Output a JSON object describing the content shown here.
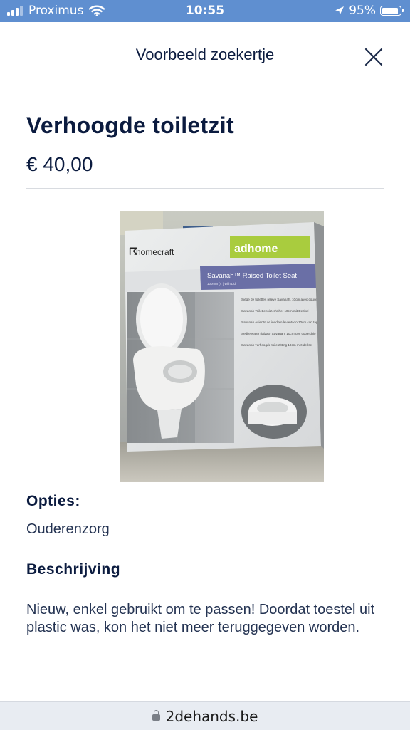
{
  "status_bar": {
    "carrier": "Proximus",
    "time": "10:55",
    "battery": "95%",
    "battery_level": 0.95,
    "signal_bars_active": 3,
    "signal_bars_total": 4,
    "wifi_icon": "wifi-icon",
    "location_icon": "location-arrow-icon"
  },
  "header": {
    "title": "Voorbeeld zoekertje",
    "close_icon": "close-icon"
  },
  "ad": {
    "title": "Verhoogde toiletzit",
    "price": "€ 40,00",
    "photo": {
      "brand": "homecraft",
      "sub_brand": "adhome",
      "product_name": "Savanah™ Raised Toilet Seat",
      "product_sub": "100mm (4\") with Lid",
      "multilang_text": [
        "Siège de toilettes relevé Savanah, 10cm avec couvercle",
        "Savanah Toilettensitzerhöher 10cm mit Deckel",
        "Savanah Asiento de inodoro levantado 10cm con tapa",
        "Sedile water rialzato Savanah, 10cm con coperchio",
        "Savanah verhoogde toiletzitting 10cm met deksel"
      ]
    },
    "options_label": "Opties:",
    "options_value": "Ouderenzorg",
    "description_label": "Beschrijving",
    "description": "Nieuw, enkel gebruikt om te passen! Doordat toestel uit plastic was, kon het niet meer teruggegeven worden."
  },
  "browser": {
    "url": "2dehands.be",
    "lock_icon": "lock-icon"
  },
  "colors": {
    "status_bar_bg": "#5f8fd0",
    "text_primary": "#0b1b3f",
    "box_purple": "#6a6fa6",
    "box_green": "#a9cc3e"
  }
}
